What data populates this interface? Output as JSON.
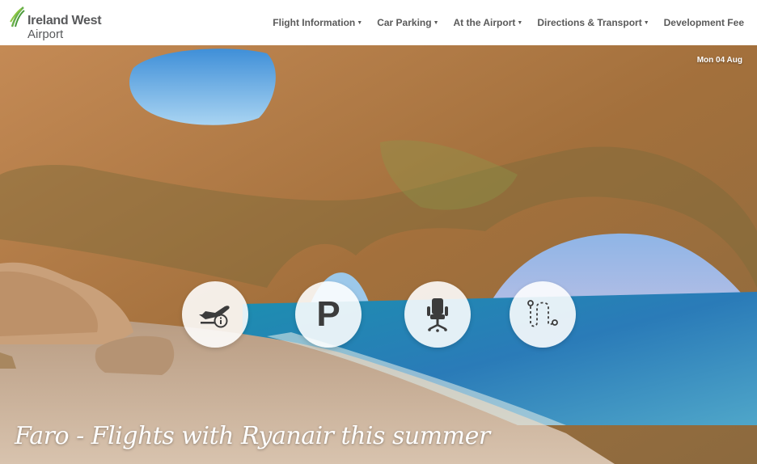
{
  "brand": {
    "name_line1": "Ireland West",
    "name_line2": "Airport",
    "color": "#58595b",
    "accent": "#6ab04c"
  },
  "nav": {
    "items": [
      {
        "label": "Flight Information",
        "dropdown": true
      },
      {
        "label": "Car Parking",
        "dropdown": true
      },
      {
        "label": "At the Airport",
        "dropdown": true
      },
      {
        "label": "Directions & Transport",
        "dropdown": true
      },
      {
        "label": "Development Fee",
        "dropdown": false
      }
    ]
  },
  "hero": {
    "date": "Mon 04 Aug",
    "caption": "Faro - Flights with Ryanair this summer",
    "quick_links": [
      {
        "icon": "plane-info-icon"
      },
      {
        "icon": "parking-icon",
        "text": "P"
      },
      {
        "icon": "seat-icon"
      },
      {
        "icon": "route-icon"
      }
    ]
  }
}
